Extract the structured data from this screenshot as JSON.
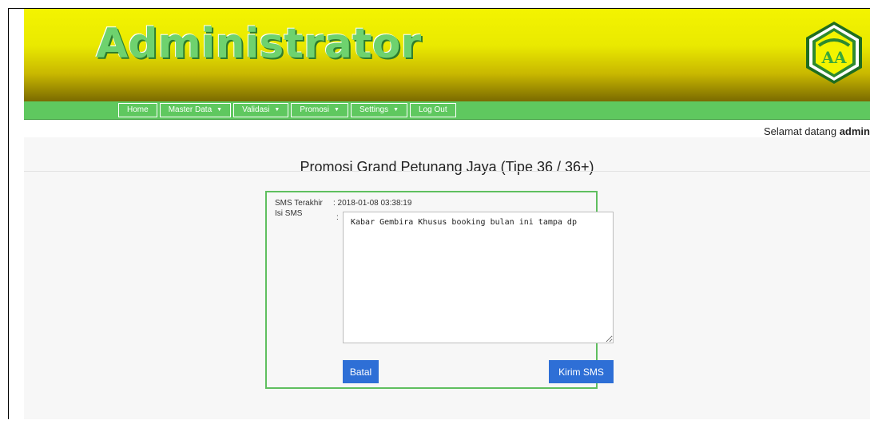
{
  "header": {
    "title": "Administrator",
    "logo_text": "AA",
    "logo_icon": "logo-emblem-icon"
  },
  "nav": {
    "items": [
      {
        "label": "Home",
        "has_dropdown": false
      },
      {
        "label": "Master Data",
        "has_dropdown": true
      },
      {
        "label": "Validasi",
        "has_dropdown": true
      },
      {
        "label": "Promosi",
        "has_dropdown": true
      },
      {
        "label": "Settings",
        "has_dropdown": true
      },
      {
        "label": "Log Out",
        "has_dropdown": false
      }
    ]
  },
  "welcome": {
    "prefix": "Selamat datang",
    "user": "admin"
  },
  "page": {
    "title": "Promosi Grand Petunang Jaya (Tipe 36 / 36+)"
  },
  "form": {
    "last_sms_label": "SMS Terakhir",
    "last_sms_value": ": 2018-01-08 03:38:19",
    "sms_label": "Isi SMS",
    "sms_colon": ":",
    "sms_value": "Kabar Gembira Khusus booking bulan ini tampa dp",
    "cancel_label": "Batal",
    "send_label": "Kirim SMS"
  },
  "colors": {
    "nav_green": "#5fc85f",
    "button_blue": "#2e6fd6",
    "panel_border": "#5fbf5f",
    "title_green": "#6ed26e"
  }
}
